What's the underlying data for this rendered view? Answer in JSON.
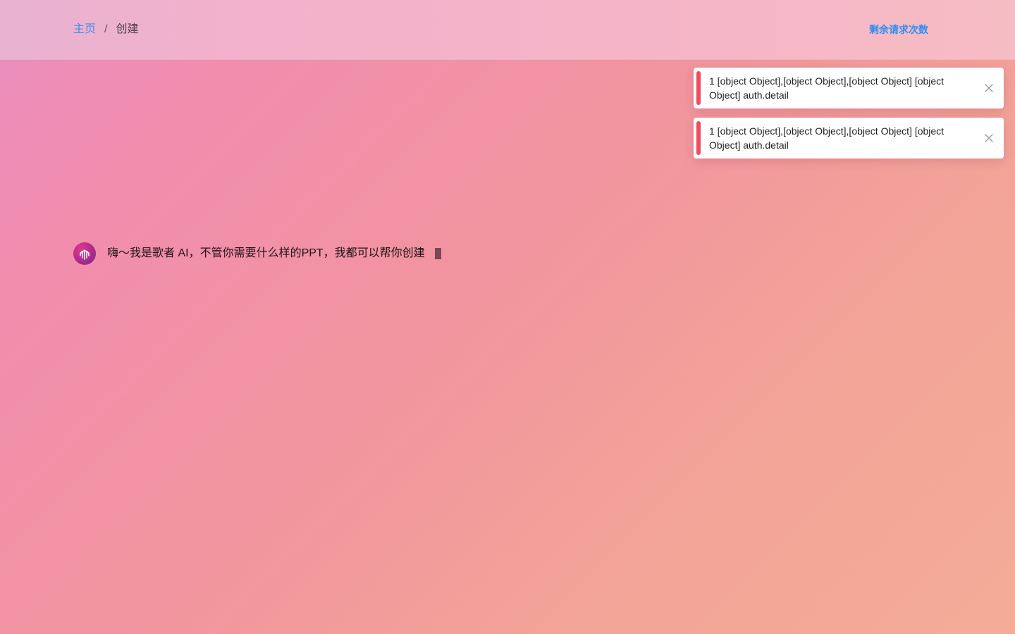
{
  "header": {
    "breadcrumb": {
      "home": "主页",
      "separator": "/",
      "current": "创建"
    },
    "quota_label": "剩余请求次数"
  },
  "toasts": [
    {
      "message": "1 [object Object],[object Object],[object Object] [object Object] auth.detail",
      "type": "error"
    },
    {
      "message": "1 [object Object],[object Object],[object Object] [object Object] auth.detail",
      "type": "error"
    }
  ],
  "chat": {
    "greeting": "嗨～我是歌者 AI，不管你需要什么样的PPT，我都可以帮你创建"
  },
  "colors": {
    "accent": "#3e8fe8",
    "error": "#ef4e5a"
  }
}
